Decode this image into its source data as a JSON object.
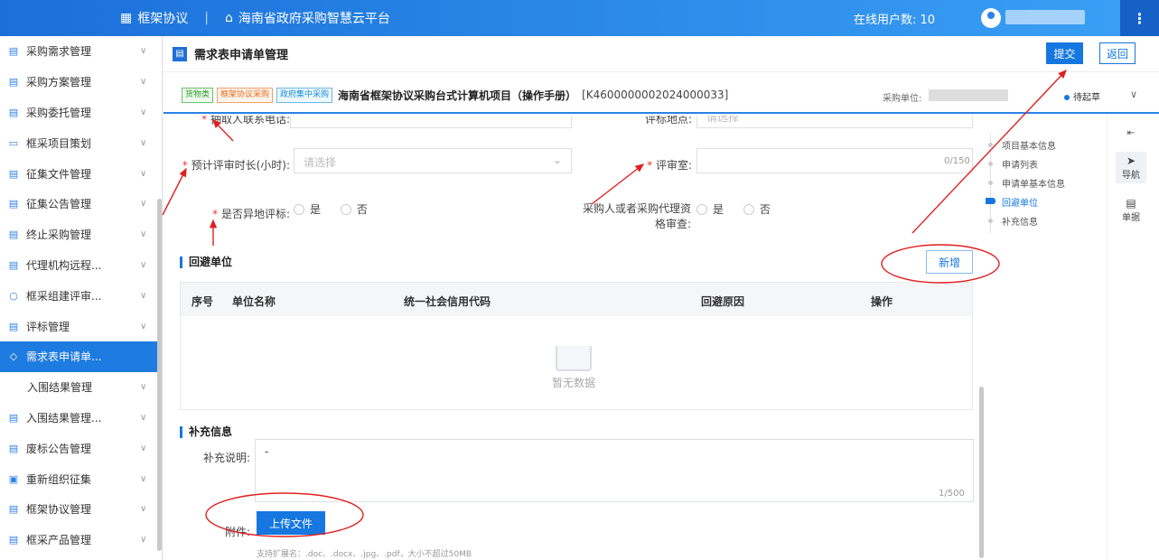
{
  "topbar": {
    "brand": "框架协议",
    "platform": "海南省政府采购智慧云平台",
    "online_label": "在线用户数: 10",
    "more": "⋮"
  },
  "sidebar": {
    "items": [
      {
        "label": "采购需求管理",
        "icon": "doc-icon"
      },
      {
        "label": "采购方案管理",
        "icon": "doc-icon"
      },
      {
        "label": "采购委托管理",
        "icon": "doc-icon"
      },
      {
        "label": "框采项目策划",
        "icon": "folder-icon"
      },
      {
        "label": "征集文件管理",
        "icon": "doc-icon"
      },
      {
        "label": "征集公告管理",
        "icon": "doc-icon"
      },
      {
        "label": "终止采购管理",
        "icon": "doc-icon"
      },
      {
        "label": "代理机构远程...",
        "icon": "doc-icon"
      },
      {
        "label": "框采组建评审...",
        "icon": "user-icon"
      },
      {
        "label": "评标管理",
        "icon": "doc-icon"
      },
      {
        "label": "需求表申请单...",
        "icon": "diamond-icon",
        "active": true
      },
      {
        "label": "入围结果管理",
        "icon": "",
        "sub": true
      },
      {
        "label": "入围结果管理...",
        "icon": "doc-icon"
      },
      {
        "label": "废标公告管理",
        "icon": "doc-icon"
      },
      {
        "label": "重新组织征集",
        "icon": "grid-icon"
      },
      {
        "label": "框架协议管理",
        "icon": "doc-icon"
      },
      {
        "label": "框采产品管理",
        "icon": "doc-icon"
      }
    ]
  },
  "header": {
    "title": "需求表申请单管理",
    "submit": "提交",
    "back": "返回"
  },
  "project": {
    "tags": [
      "货物类",
      "框架协议采购",
      "政府集中采购"
    ],
    "name": "海南省框架协议采购台式计算机项目（操作手册）",
    "code": "[K4600000002024000033]",
    "unit_label": "采购单位:",
    "status": "待起草"
  },
  "form": {
    "phone_label": "抽取人联系电话:",
    "place_label": "评标地点:",
    "place_placeholder": "请选择",
    "duration_label": "预计评审时长(小时):",
    "duration_placeholder": "请选择",
    "room_label": "评审室:",
    "room_counter": "0/150",
    "remote_label": "是否异地评标:",
    "review_label_1": "采购人或者采购代理资",
    "review_label_2": "格审查:",
    "yes": "是",
    "no": "否"
  },
  "avoid": {
    "section_title": "回避单位",
    "add_button": "新增",
    "columns": [
      "序号",
      "单位名称",
      "统一社会信用代码",
      "回避原因",
      "操作"
    ],
    "empty_text": "暂无数据"
  },
  "supplement": {
    "section_title": "补充信息",
    "desc_label": "补充说明:",
    "desc_value": "-",
    "desc_counter": "1/500",
    "attach_label": "附件:",
    "upload_button": "上传文件",
    "hint": "支持扩展名：.doc、.docx、.jpg、.pdf，大小不超过50MB"
  },
  "anchor_nav": {
    "items": [
      "项目基本信息",
      "申请列表",
      "申请单基本信息",
      "回避单位",
      "补充信息"
    ],
    "active": "回避单位"
  },
  "right_panel": {
    "collapse": "⇤",
    "nav_label": "导航",
    "doc_label": "单据"
  },
  "colors": {
    "primary": "#1677e0",
    "annotation": "#e02020"
  }
}
